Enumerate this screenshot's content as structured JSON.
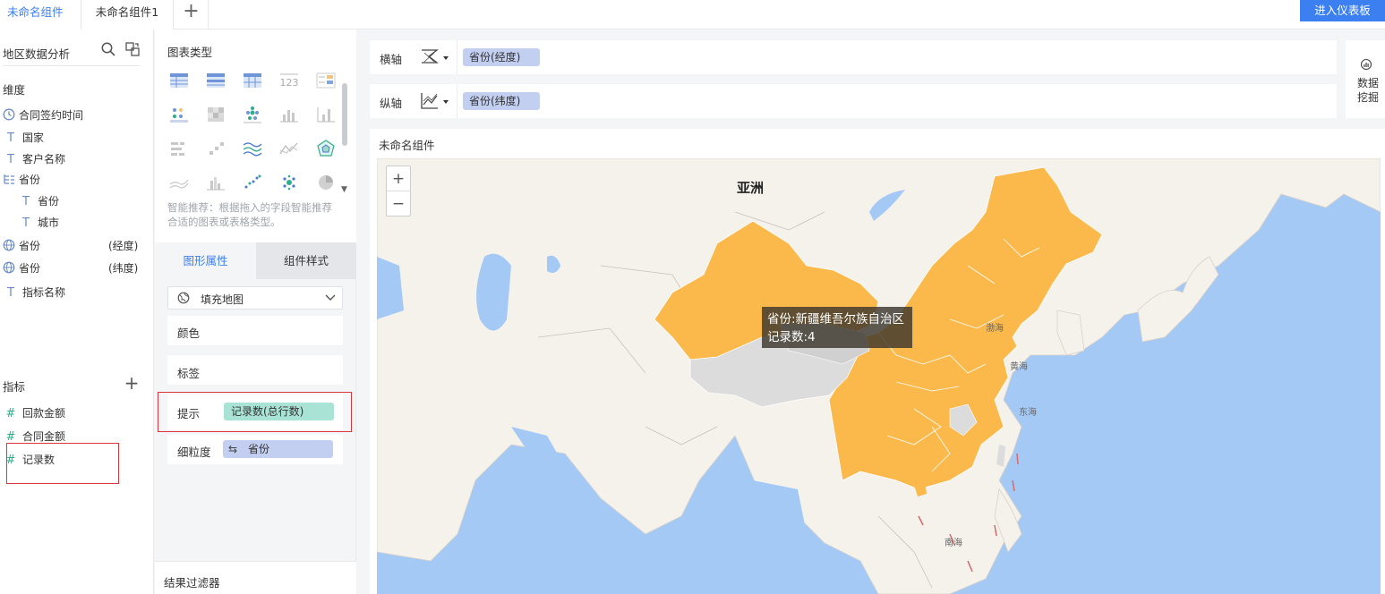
{
  "tabs": {
    "active": "未命名组件",
    "inactive": "未命名组件1",
    "add": "+"
  },
  "header": {
    "enter_dashboard": "进入仪表板"
  },
  "field_panel": {
    "dataset_title": "地区数据分析",
    "dimension_label": "维度",
    "dimensions": [
      {
        "label": "合同签约时间",
        "icon": "clock-icon"
      },
      {
        "label": "国家",
        "icon": "text-type-icon"
      },
      {
        "label": "客户名称",
        "icon": "text-type-icon"
      },
      {
        "label": "省份",
        "icon": "tree-icon"
      },
      {
        "label": "省份",
        "icon": "text-type-icon"
      },
      {
        "label": "城市",
        "icon": "text-type-icon"
      },
      {
        "label": "省份",
        "suffix": "(经度)",
        "icon": "globe-icon"
      },
      {
        "label": "省份",
        "suffix": "(纬度)",
        "icon": "globe-icon"
      },
      {
        "label": "指标名称",
        "icon": "text-type-icon"
      }
    ],
    "measure_label": "指标",
    "measures": [
      {
        "label": "回款金额",
        "icon": "hash-icon"
      },
      {
        "label": "合同金额",
        "icon": "hash-icon"
      },
      {
        "label": "记录数",
        "icon": "hash-icon"
      }
    ]
  },
  "config_panel": {
    "chart_type_title": "图表类型",
    "recommend_text": "智能推荐：根据拖入的字段智能推荐合适的图表或表格类型。",
    "tab_graphic": "图形属性",
    "tab_style": "组件样式",
    "map_type": "填充地图",
    "props": {
      "color": "颜色",
      "label": "标签",
      "tooltip": "提示",
      "tooltip_field": "记录数(总行数)",
      "granularity": "细粒度",
      "granularity_field": "省份"
    },
    "result_filter": "结果过滤器"
  },
  "axes": {
    "x_label": "横轴",
    "x_field": "省份(经度)",
    "y_label": "纵轴",
    "y_field": "省份(纬度)"
  },
  "mining": {
    "line1": "数据",
    "line2": "挖掘"
  },
  "component": {
    "title": "未命名组件"
  },
  "map": {
    "zoom_in": "+",
    "zoom_out": "−",
    "continent": "亚洲",
    "labels": {
      "bohai": "渤海",
      "yellow_sea": "黄海",
      "east_sea": "东海",
      "south_sea": "南海"
    },
    "tooltip": {
      "line1": "省份:新疆维吾尔族自治区",
      "line2": "记录数:4"
    },
    "colors": {
      "water": "#a5c9f5",
      "land": "#f5f2ec",
      "filled": "#fbb94c",
      "nodata": "#dcdcdc"
    }
  }
}
